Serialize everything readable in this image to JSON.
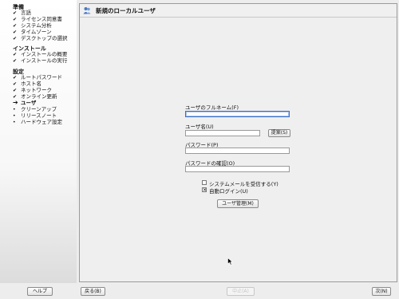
{
  "sidebar": {
    "sections": [
      {
        "title": "準備",
        "items": [
          {
            "label": "言語",
            "mark": "✔"
          },
          {
            "label": "ライセンス同意書",
            "mark": "✔"
          },
          {
            "label": "システム分析",
            "mark": "✔"
          },
          {
            "label": "タイムゾーン",
            "mark": "✔"
          },
          {
            "label": "デスクトップの選択",
            "mark": "✔"
          }
        ]
      },
      {
        "title": "インストール",
        "items": [
          {
            "label": "インストールの概要",
            "mark": "✔"
          },
          {
            "label": "インストールの実行",
            "mark": "✔"
          }
        ]
      },
      {
        "title": "設定",
        "items": [
          {
            "label": "ルートパスワード",
            "mark": "✔"
          },
          {
            "label": "ホスト名",
            "mark": "✔"
          },
          {
            "label": "ネットワーク",
            "mark": "✔"
          },
          {
            "label": "オンライン更新",
            "mark": "✔"
          },
          {
            "label": "ユーザ",
            "mark": "➔",
            "current": true
          },
          {
            "label": "クリーンアップ",
            "mark": "•"
          },
          {
            "label": "リリースノート",
            "mark": "•"
          },
          {
            "label": "ハードウェア設定",
            "mark": "•"
          }
        ]
      }
    ]
  },
  "panel": {
    "title": "新規のローカルユーザ",
    "fullname_label": "ユーザのフルネーム(F)",
    "fullname_value": "",
    "username_label": "ユーザ名(U)",
    "username_value": "",
    "suggest_button": "提案(S)",
    "password_label": "パスワード(P)",
    "password_value": "",
    "confirm_label": "パスワードの確認(O)",
    "confirm_value": "",
    "receive_mail_label": "システムメールを受信する(Y)",
    "receive_mail_checked": false,
    "autologin_label": "自動ログイン(U)",
    "autologin_checked": true,
    "user_mgmt_button": "ユーザ管理(M)"
  },
  "footer": {
    "help": "ヘルプ",
    "back": "戻る(B)",
    "abort": "中止(A)",
    "next": "次(N)"
  },
  "colors": {
    "focus_border": "#3b6fc7",
    "panel_bg": "#efefef"
  }
}
